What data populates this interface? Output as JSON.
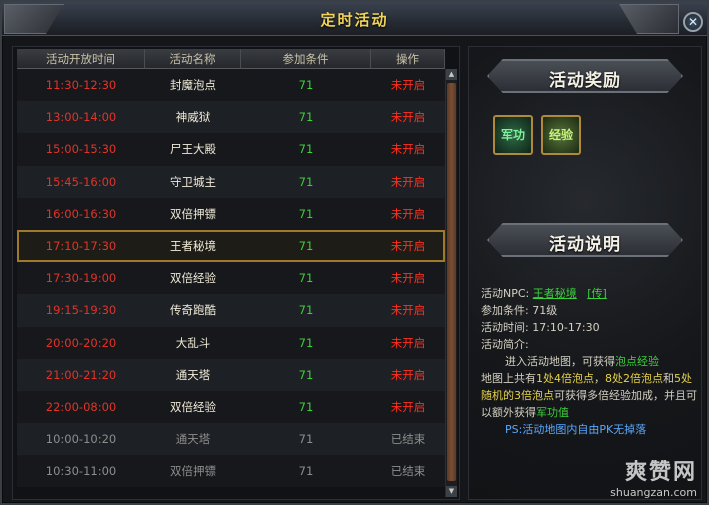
{
  "window": {
    "title": "定时活动",
    "close_label": "✕"
  },
  "table": {
    "headers": [
      "活动开放时间",
      "活动名称",
      "参加条件",
      "操作"
    ],
    "rows": [
      {
        "time": "11:30-12:30",
        "name": "封魔泡点",
        "level": "71",
        "status": "未开启"
      },
      {
        "time": "13:00-14:00",
        "name": "神威狱",
        "level": "71",
        "status": "未开启"
      },
      {
        "time": "15:00-15:30",
        "name": "尸王大殿",
        "level": "71",
        "status": "未开启"
      },
      {
        "time": "15:45-16:00",
        "name": "守卫城主",
        "level": "71",
        "status": "未开启"
      },
      {
        "time": "16:00-16:30",
        "name": "双倍押镖",
        "level": "71",
        "status": "未开启"
      },
      {
        "time": "17:10-17:30",
        "name": "王者秘境",
        "level": "71",
        "status": "未开启"
      },
      {
        "time": "17:30-19:00",
        "name": "双倍经验",
        "level": "71",
        "status": "未开启"
      },
      {
        "time": "19:15-19:30",
        "name": "传奇跑酷",
        "level": "71",
        "status": "未开启"
      },
      {
        "time": "20:00-20:20",
        "name": "大乱斗",
        "level": "71",
        "status": "未开启"
      },
      {
        "time": "21:00-21:20",
        "name": "通天塔",
        "level": "71",
        "status": "未开启"
      },
      {
        "time": "22:00-08:00",
        "name": "双倍经验",
        "level": "71",
        "status": "未开启"
      },
      {
        "time": "10:00-10:20",
        "name": "通天塔",
        "level": "71",
        "status": "已结束"
      },
      {
        "time": "10:30-11:00",
        "name": "双倍押镖",
        "level": "71",
        "status": "已结束"
      }
    ]
  },
  "rewards": {
    "heading": "活动奖励",
    "items": [
      {
        "label": "军功"
      },
      {
        "label": "经验"
      }
    ]
  },
  "description": {
    "heading": "活动说明",
    "npc_label": "活动NPC:",
    "npc_name": "王者秘境",
    "npc_link": "[传]",
    "cond_label": "参加条件:",
    "cond_value": "71级",
    "time_label": "活动时间:",
    "time_value": "17:10-17:30",
    "summary_label": "活动简介:",
    "p1_a": "进入活动地图，可获得",
    "p1_b": "泡点经验",
    "p2_a": "地图上共有",
    "p2_b": "1处4倍泡点",
    "p2_c": "，",
    "p2_d": "8处2倍泡点",
    "p2_e": "和",
    "p2_f": "5处随机的3倍泡点",
    "p2_g": "可获得多倍经验加成，并且可以额外获得",
    "p2_h": "军功值",
    "ps": "PS:活动地图内自由PK无掉落"
  },
  "watermark": {
    "logo": "爽赞网",
    "url": "shuangzan.com"
  },
  "colors": {
    "time_red": "#e0342a",
    "level_green": "#3ad13a",
    "status_red": "#ff3020",
    "done_gray": "#8d8d8d",
    "title_gold": "#f0d45a"
  }
}
